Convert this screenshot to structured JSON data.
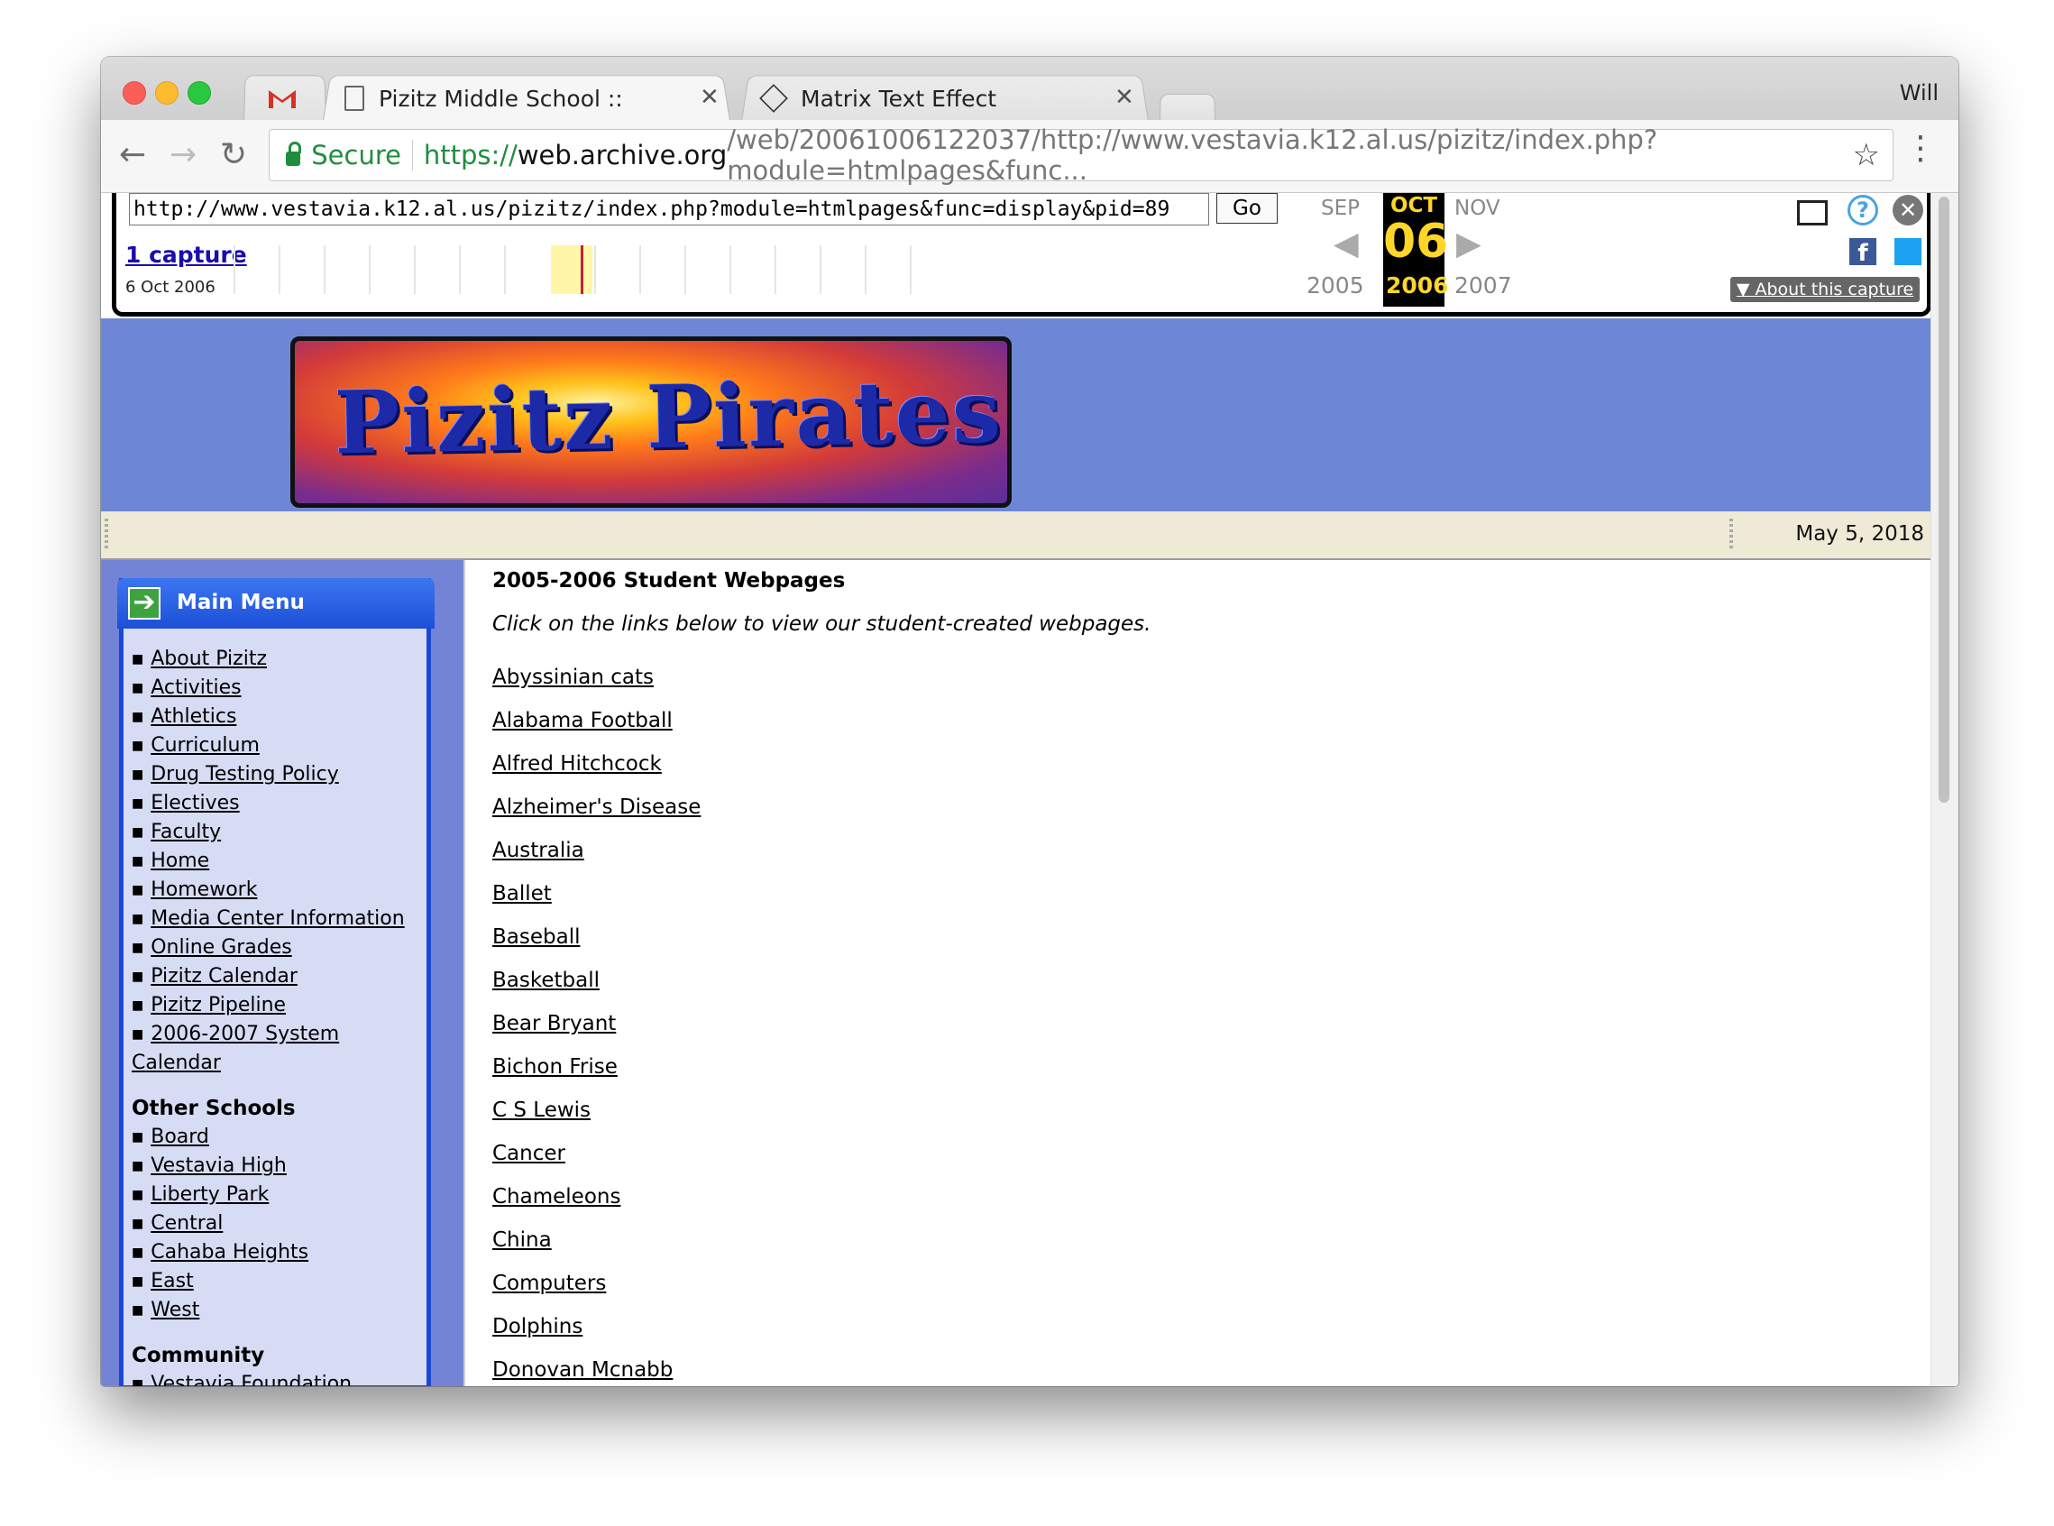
{
  "browser": {
    "tabs": [
      {
        "label": "",
        "icon": "gmail-icon"
      },
      {
        "label": "Pizitz Middle School ::",
        "icon": "page-icon"
      },
      {
        "label": "Matrix Text Effect",
        "icon": "codepen-icon"
      }
    ],
    "user": "Will",
    "secure_label": "Secure",
    "url_scheme": "https://",
    "url_host": "web.archive.org",
    "url_path": "/web/20061006122037/http://www.vestavia.k12.al.us/pizitz/index.php?module=htmlpages&func..."
  },
  "wayback": {
    "url_value": "http://www.vestavia.k12.al.us/pizitz/index.php?module=htmlpages&func=display&pid=89",
    "go_label": "Go",
    "captures_label": "1 capture",
    "capture_date": "6 Oct 2006",
    "prev_month": "SEP",
    "cur_month": "OCT",
    "next_month": "NOV",
    "day": "06",
    "prev_year": "2005",
    "cur_year": "2006",
    "next_year": "2007",
    "about_label": "About this capture"
  },
  "site": {
    "banner_text": "Pizitz Pirates",
    "date": "May 5, 2018"
  },
  "menu": {
    "title": "Main Menu",
    "items": [
      "About Pizitz",
      "Activities",
      "Athletics",
      "Curriculum",
      "Drug Testing Policy",
      "Electives",
      "Faculty",
      "Home",
      "Homework",
      "Media Center Information",
      "Online Grades",
      "Pizitz Calendar",
      "Pizitz Pipeline",
      "2006-2007 System Calendar"
    ],
    "other_schools_heading": "Other Schools",
    "other_schools": [
      "Board ",
      "Vestavia High ",
      "Liberty Park ",
      "Central ",
      "Cahaba Heights",
      "East ",
      "West "
    ],
    "community_heading": "Community",
    "community": [
      "Vestavia Foundation"
    ]
  },
  "content": {
    "title": "2005-2006 Student Webpages",
    "intro": "Click on the links below to view our student-created webpages.",
    "links": [
      "Abyssinian cats",
      "Alabama Football",
      "Alfred Hitchcock",
      "Alzheimer's Disease",
      "Australia",
      "Ballet",
      "Baseball",
      "Basketball",
      "Bear Bryant",
      "Bichon Frise",
      "C S Lewis",
      "Cancer",
      "Chameleons",
      "China",
      "Computers",
      "Dolphins",
      "Donovan Mcnabb"
    ]
  }
}
